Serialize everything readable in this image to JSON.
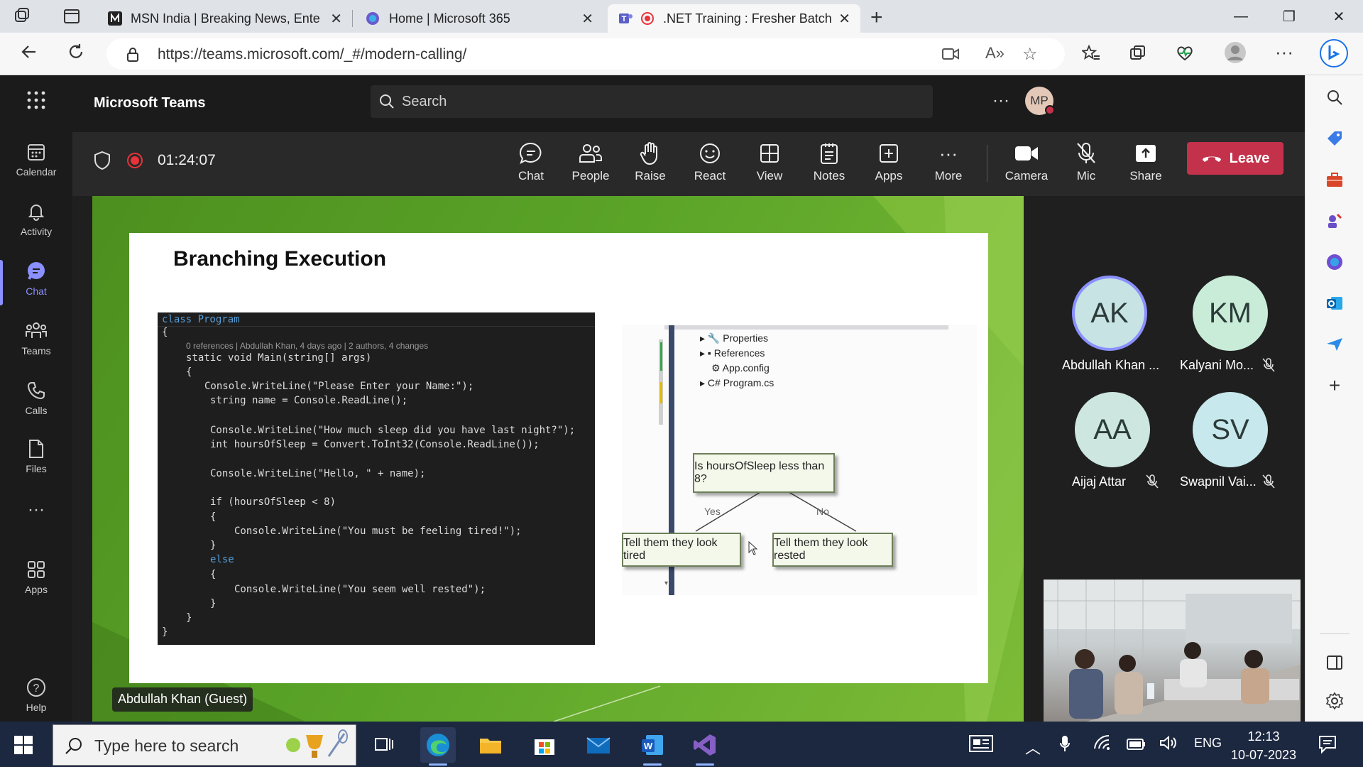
{
  "browser": {
    "tabs": [
      {
        "title": "MSN India | Breaking News, Ente",
        "icon": "msn-icon"
      },
      {
        "title": "Home | Microsoft 365",
        "icon": "m365-icon"
      },
      {
        "title": ".NET Training : Fresher Batch",
        "icon": "teams-icon"
      }
    ],
    "url": "https://teams.microsoft.com/_#/modern-calling/"
  },
  "teams": {
    "app_name": "Microsoft Teams",
    "search_placeholder": "Search",
    "profile_initials": "MP",
    "rail": [
      {
        "label": "Calendar",
        "icon": "calendar-icon"
      },
      {
        "label": "Activity",
        "icon": "bell-icon"
      },
      {
        "label": "Chat",
        "icon": "chat-icon",
        "active": true
      },
      {
        "label": "Teams",
        "icon": "teams-icon"
      },
      {
        "label": "Calls",
        "icon": "phone-icon"
      },
      {
        "label": "Files",
        "icon": "file-icon"
      },
      {
        "label": "",
        "icon": "more-icon"
      },
      {
        "label": "Apps",
        "icon": "apps-icon"
      },
      {
        "label": "Help",
        "icon": "help-icon"
      }
    ]
  },
  "meeting": {
    "timer": "01:24:07",
    "controls": [
      {
        "label": "Chat",
        "icon": "chat-icon"
      },
      {
        "label": "People",
        "icon": "people-icon"
      },
      {
        "label": "Raise",
        "icon": "hand-icon"
      },
      {
        "label": "React",
        "icon": "smile-icon"
      },
      {
        "label": "View",
        "icon": "grid-icon"
      },
      {
        "label": "Notes",
        "icon": "notes-icon"
      },
      {
        "label": "Apps",
        "icon": "plus-box-icon"
      },
      {
        "label": "More",
        "icon": "more-icon"
      },
      {
        "label": "Camera",
        "icon": "camera-icon"
      },
      {
        "label": "Mic",
        "icon": "mic-off-icon"
      },
      {
        "label": "Share",
        "icon": "share-icon"
      }
    ],
    "leave_label": "Leave",
    "presenter": "Abdullah Khan (Guest)",
    "participants": [
      {
        "initials": "AK",
        "name": "Abdullah Khan ...",
        "muted": false,
        "speaking": true
      },
      {
        "initials": "KM",
        "name": "Kalyani Mo...",
        "muted": true
      },
      {
        "initials": "AA",
        "name": "Aijaj Attar",
        "muted": true
      },
      {
        "initials": "SV",
        "name": "Swapnil Vai...",
        "muted": true
      }
    ]
  },
  "slide": {
    "title": "Branching Execution",
    "code": [
      "class Program",
      "{",
      "0 references | Abdullah Khan, 4 days ago | 2 authors, 4 changes",
      "static void Main(string[] args)",
      "{",
      "Console.WriteLine(\"Please Enter your Name:\");",
      "string name = Console.ReadLine();",
      "Console.WriteLine(\"How much sleep did you have last night?\");",
      "int hoursOfSleep = Convert.ToInt32(Console.ReadLine());",
      "Console.WriteLine(\"Hello, \" + name);",
      "if (hoursOfSleep < 8)",
      "{",
      "Console.WriteLine(\"You must be feeling tired!\");",
      "}",
      "else",
      "{",
      "Console.WriteLine(\"You seem well rested\");",
      "}",
      "}",
      "}"
    ],
    "tree": [
      "Properties",
      "References",
      "App.config",
      "Program.cs"
    ],
    "decision": "Is hoursOfSleep less than 8?",
    "yes_label": "Yes",
    "no_label": "No",
    "yes_result": "Tell them they look tired",
    "no_result": "Tell them they look rested"
  },
  "taskbar": {
    "search_placeholder": "Type here to search",
    "language": "ENG",
    "time": "12:13",
    "date": "10-07-2023"
  },
  "colors": {
    "teams_accent": "#8a90ff",
    "leave_red": "#c4314b",
    "recording_red": "#e8333a"
  }
}
